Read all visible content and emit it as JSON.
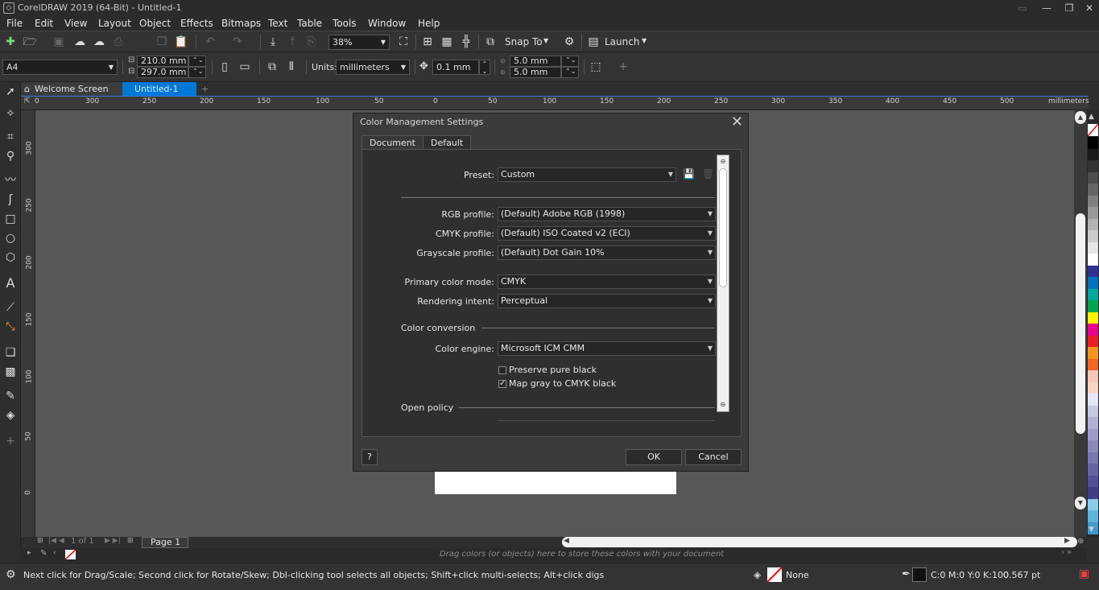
{
  "window": {
    "title": "CorelDRAW 2019 (64-Bit) - Untitled-1"
  },
  "menu": [
    "File",
    "Edit",
    "View",
    "Layout",
    "Object",
    "Effects",
    "Bitmaps",
    "Text",
    "Table",
    "Tools",
    "Window",
    "Help"
  ],
  "toolbar": {
    "zoom": "38%",
    "snap_label": "Snap To",
    "launch_label": "Launch"
  },
  "propbar": {
    "page_size": "A4",
    "width": "210.0 mm",
    "height": "297.0 mm",
    "units_label": "Units:",
    "units_value": "millimeters",
    "nudge": "0.1 mm",
    "dup_x": "5.0 mm",
    "dup_y": "5.0 mm"
  },
  "doc_tabs": {
    "welcome": "Welcome Screen",
    "doc": "Untitled-1"
  },
  "ruler": {
    "h_ticks": [
      "300",
      "250",
      "200",
      "150",
      "100",
      "50",
      "0",
      "50",
      "100",
      "150",
      "200",
      "250",
      "300",
      "350",
      "400",
      "450",
      "500"
    ],
    "h_unit": "millimeters",
    "v_ticks": [
      "300",
      "250",
      "200",
      "150",
      "100",
      "50",
      "0"
    ]
  },
  "dialog": {
    "title": "Color Management Settings",
    "tabs": [
      "Document",
      "Default"
    ],
    "preset_label": "Preset:",
    "preset_value": "Custom",
    "rgb_label": "RGB profile:",
    "rgb_value": "(Default) Adobe RGB (1998)",
    "cmyk_label": "CMYK profile:",
    "cmyk_value": "(Default) ISO Coated v2 (ECI)",
    "gray_label": "Grayscale profile:",
    "gray_value": "(Default) Dot Gain 10%",
    "mode_label": "Primary color mode:",
    "mode_value": "CMYK",
    "intent_label": "Rendering intent:",
    "intent_value": "Perceptual",
    "conversion_heading": "Color conversion",
    "engine_label": "Color engine:",
    "engine_value": "Microsoft ICM CMM",
    "preserve_black_label": "Preserve pure black",
    "preserve_black_checked": false,
    "map_gray_label": "Map gray to CMYK black",
    "map_gray_checked": true,
    "open_policy_heading": "Open policy",
    "help_label": "?",
    "ok_label": "OK",
    "cancel_label": "Cancel"
  },
  "pagebar": {
    "page_counter": "1  of  1",
    "page_tab": "Page 1"
  },
  "colorbar": {
    "hint": "Drag colors (or objects) here to store these colors with your document"
  },
  "status": {
    "message": "Next click for Drag/Scale; Second click for Rotate/Skew; Dbl-clicking tool selects all objects; Shift+click multi-selects; Alt+click digs",
    "fill_label": "None",
    "outline_color": "C:0 M:0 Y:0 K:100",
    "outline_width": "0.567 pt"
  },
  "palette_colors": [
    "#000000",
    "#1a1a1a",
    "#333333",
    "#4d4d4d",
    "#666666",
    "#808080",
    "#999999",
    "#b3b3b3",
    "#cccccc",
    "#e6e6e6",
    "#ffffff",
    "#2e3192",
    "#0071bc",
    "#00a99d",
    "#00a651",
    "#fff200",
    "#ec008c",
    "#ed1c24",
    "#f7941d",
    "#f26522",
    "#f9c7b9",
    "#fbd5c4",
    "#e6e6fa",
    "#c8c8e6",
    "#b0b0d8",
    "#9c9ccc",
    "#8a8abf",
    "#7777b2",
    "#6464a5",
    "#515198",
    "#3e3e8b",
    "#87ceeb",
    "#5fb4dc",
    "#3b9bcd"
  ]
}
